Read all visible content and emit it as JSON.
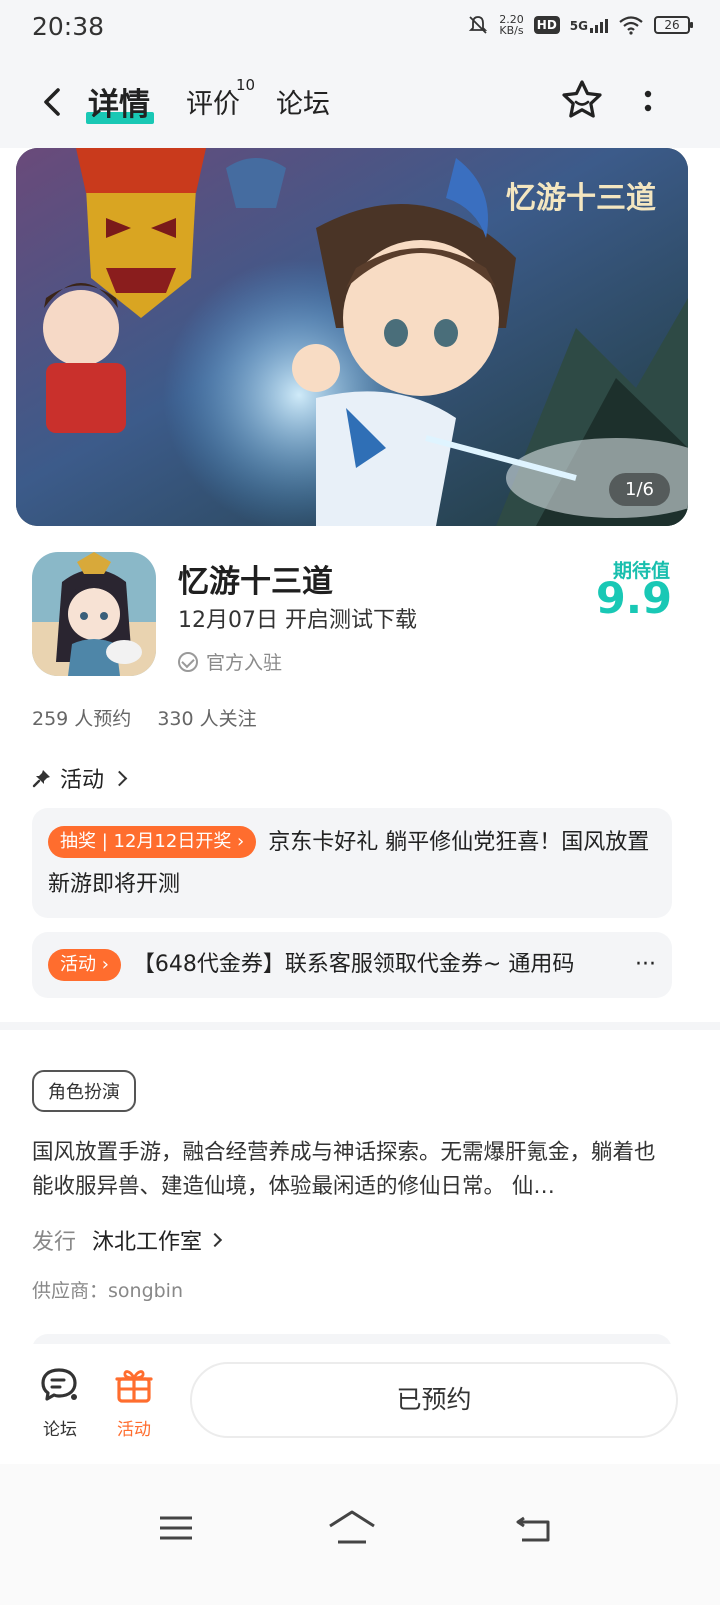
{
  "status_bar": {
    "time": "20:38",
    "speed_value": "2.20",
    "speed_unit": "KB/s",
    "hd": "HD",
    "network": "5G",
    "battery": "26"
  },
  "header": {
    "tabs": [
      {
        "label": "详情",
        "active": true
      },
      {
        "label": "评价",
        "badge": "10"
      },
      {
        "label": "论坛"
      }
    ]
  },
  "banner": {
    "counter": "1/6",
    "logo_text": "忆游十三道"
  },
  "game": {
    "name": "忆游十三道",
    "release": "12月07日  开启测试下载",
    "official": "官方入驻",
    "expect_label": "期待值",
    "expect_value": "9.9",
    "reservations": "259 人预约",
    "followers": "330 人关注"
  },
  "activity": {
    "heading": "活动",
    "items": [
      {
        "tag": "抽奖 | 12月12日开奖 ›",
        "text": "京东卡好礼  躺平修仙党狂喜！国风放置新游即将开测"
      },
      {
        "tag": "活动 ›",
        "text": "【648代金券】联系客服领取代金券~  通用码",
        "more": "···"
      }
    ]
  },
  "details": {
    "genre": "角色扮演",
    "description": "国风放置手游，融合经营养成与神话探索。无需爆肝氪金，躺着也能收服异兽、建造仙境，体验最闲适的修仙日常。 仙…",
    "publisher_label": "发行",
    "publisher_name": "沐北工作室",
    "supplier": "供应商：songbin"
  },
  "bottom_bar": {
    "forum_label": "论坛",
    "activity_label": "活动",
    "reserve_button": "已预约"
  },
  "colors": {
    "accent": "#19c8b5",
    "orange": "#ff6d2e"
  }
}
